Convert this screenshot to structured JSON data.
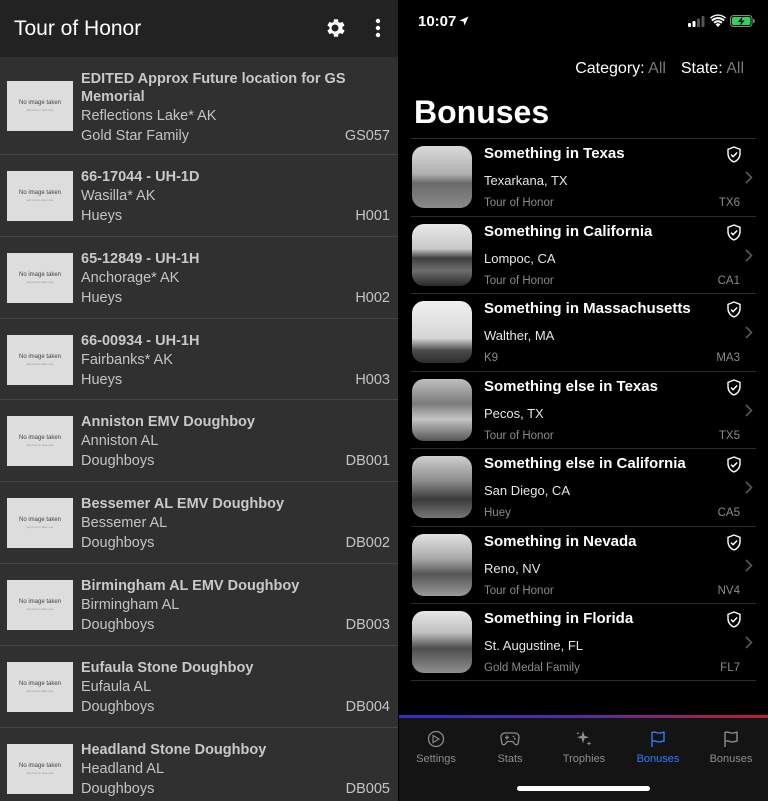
{
  "android": {
    "title": "Tour of Honor",
    "placeholder_line1": "No image taken",
    "placeholder_line2": "tap here to take one",
    "items": [
      {
        "name": "EDITED Approx Future location for GS Memorial",
        "city": "Reflections Lake* AK",
        "category": "Gold Star Family",
        "code": "GS057"
      },
      {
        "name": "66-17044 - UH-1D",
        "city": "Wasilla* AK",
        "category": "Hueys",
        "code": "H001"
      },
      {
        "name": "65-12849 - UH-1H",
        "city": "Anchorage* AK",
        "category": "Hueys",
        "code": "H002"
      },
      {
        "name": "66-00934 - UH-1H",
        "city": "Fairbanks* AK",
        "category": "Hueys",
        "code": "H003"
      },
      {
        "name": "Anniston EMV Doughboy",
        "city": "Anniston AL",
        "category": "Doughboys",
        "code": "DB001"
      },
      {
        "name": "Bessemer AL EMV Doughboy",
        "city": "Bessemer AL",
        "category": "Doughboys",
        "code": "DB002"
      },
      {
        "name": "Birmingham AL EMV Doughboy",
        "city": "Birmingham AL",
        "category": "Doughboys",
        "code": "DB003"
      },
      {
        "name": "Eufaula Stone Doughboy",
        "city": "Eufaula AL",
        "category": "Doughboys",
        "code": "DB004"
      },
      {
        "name": "Headland Stone Doughboy",
        "city": "Headland AL",
        "category": "Doughboys",
        "code": "DB005"
      }
    ]
  },
  "ios": {
    "time": "10:07",
    "filter_category_label": "Category:",
    "filter_category_value": "All",
    "filter_state_label": "State:",
    "filter_state_value": "All",
    "title": "Bonuses",
    "rows": [
      {
        "name": "Something in Texas",
        "city": "Texarkana, TX",
        "category": "Tour of Honor",
        "code": "TX6"
      },
      {
        "name": "Something in California",
        "city": "Lompoc, CA",
        "category": "Tour of Honor",
        "code": "CA1"
      },
      {
        "name": "Something in Massachusetts",
        "city": "Walther, MA",
        "category": "K9",
        "code": "MA3"
      },
      {
        "name": "Something else in Texas",
        "city": "Pecos, TX",
        "category": "Tour of Honor",
        "code": "TX5"
      },
      {
        "name": "Something else in California",
        "city": "San Diego, CA",
        "category": "Huey",
        "code": "CA5"
      },
      {
        "name": "Something in Nevada",
        "city": "Reno, NV",
        "category": "Tour of Honor",
        "code": "NV4"
      },
      {
        "name": "Something in Florida",
        "city": "St. Augustine, FL",
        "category": "Gold Medal Family",
        "code": "FL7"
      }
    ],
    "tabs": [
      {
        "label": "Settings",
        "icon": "settings-icon"
      },
      {
        "label": "Stats",
        "icon": "gamepad-icon"
      },
      {
        "label": "Trophies",
        "icon": "sparkles-icon"
      },
      {
        "label": "Bonuses",
        "icon": "flag-icon",
        "active": true
      },
      {
        "label": "Bonuses",
        "icon": "flag-icon"
      }
    ],
    "accent_color": "#2f7bff"
  }
}
